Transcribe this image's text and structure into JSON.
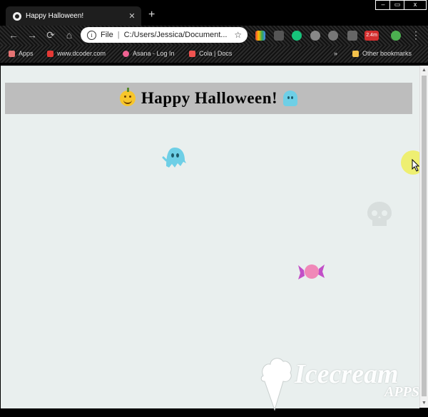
{
  "browser": {
    "tab": {
      "title": "Happy Halloween!",
      "close_icon": "close-icon",
      "favicon": "globe-icon"
    },
    "new_tab_symbol": "+",
    "window_controls": {
      "minimize": "–",
      "restore": "▭",
      "close": "x"
    },
    "address_bar": {
      "scheme_label": "File",
      "url": "C:/Users/Jessica/Document..."
    },
    "bookmarks": [
      {
        "label": "Apps",
        "color": "#e57373"
      },
      {
        "label": "www.dcoder.com",
        "color": "#e53935"
      },
      {
        "label": "Asana - Log In",
        "color": "#f06292"
      },
      {
        "label": "Cola | Docs",
        "color": "#ef5350"
      }
    ],
    "other_bookmarks_label": "Other bookmarks",
    "extension_badge": "2.4m"
  },
  "page": {
    "heading": "Happy Halloween!",
    "heading_icons": [
      "pumpkin-icon",
      "ghost-icon"
    ],
    "sprites": [
      "ghost-icon",
      "skull-icon",
      "candy-icon"
    ]
  },
  "watermark": {
    "brand": "Icecream",
    "sub": "APPS"
  },
  "colors": {
    "page_background": "#e9efee",
    "banner": "#bdbdbd",
    "ghost": "#6ecfe6",
    "candy": "#f088b8",
    "candy_wrapper": "#c24fc7",
    "skull": "#d8dedd",
    "cursor_highlight": "#eeee5a"
  }
}
